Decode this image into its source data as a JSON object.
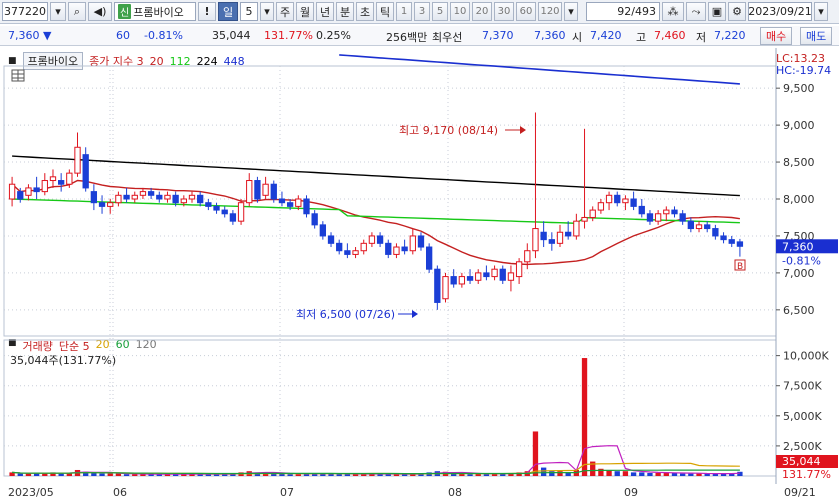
{
  "toolbar": {
    "code": "377220",
    "new_badge": "신",
    "stock_name": "프롬바이오",
    "alert_label": "!",
    "periods": [
      "일",
      "5",
      "주",
      "월",
      "년",
      "분",
      "초",
      "틱"
    ],
    "numbers": [
      "1",
      "3",
      "5",
      "10",
      "20",
      "30",
      "60",
      "120"
    ],
    "count": "92",
    "total": "/493",
    "date": "2023/09/21"
  },
  "quote": {
    "price": "7,360",
    "change": "60",
    "change_pct": "-0.81%",
    "volume": "35,044",
    "volume_ratio": "131.77%",
    "turnover_pct": "0.25%",
    "amount": "256백만",
    "best_ask_label": "최우선",
    "best_ask": "7,370",
    "best_bid": "7,360",
    "open_label": "시",
    "open": "7,420",
    "high_label": "고",
    "high": "7,460",
    "low_label": "저",
    "low": "7,220",
    "buy_label": "매수",
    "sell_label": "매도"
  },
  "legend": {
    "name": "프롬바이오",
    "series_label": "종가 지수 3",
    "ma": [
      "20",
      "112",
      "224",
      "448"
    ]
  },
  "volume_legend": {
    "label": "거래량",
    "ma_label": "단순 5",
    "ma": [
      "20",
      "60",
      "120"
    ],
    "current": "35,044주(131.77%)"
  },
  "annotations": {
    "high": "최고 9,170 (08/14)",
    "low": "최저 6,500 (07/26)",
    "lc": "LC:13.23",
    "hc": "HC:-19.74",
    "marker": "B"
  },
  "price_tag": {
    "price": "7,360",
    "pct": "-0.81%"
  },
  "volume_tag": {
    "value": "35,044",
    "pct": "131.77%"
  },
  "colors": {
    "up": "#e0141e",
    "down": "#1b3fd6",
    "ma20": "#c42020",
    "ma112": "#16c816",
    "ma224": "#000000",
    "ma448": "#1a2fd0"
  },
  "chart_data": {
    "type": "candlestick",
    "price_axis": {
      "min": 6200,
      "max": 9800,
      "ticks": [
        "9,500",
        "9,000",
        "8,500",
        "8,000",
        "7,500",
        "7,000",
        "6,500"
      ]
    },
    "volume_axis": {
      "ticks": [
        "10,000K",
        "7,500K",
        "5,000K",
        "2,500K"
      ]
    },
    "x_labels": [
      "2023/05",
      "06",
      "07",
      "08",
      "09",
      "09/21"
    ],
    "candles": [
      {
        "o": 8000,
        "h": 8300,
        "l": 7900,
        "c": 8200
      },
      {
        "o": 8100,
        "h": 8150,
        "l": 7950,
        "c": 8000
      },
      {
        "o": 8050,
        "h": 8200,
        "l": 7980,
        "c": 8150
      },
      {
        "o": 8150,
        "h": 8300,
        "l": 8000,
        "c": 8100
      },
      {
        "o": 8100,
        "h": 8350,
        "l": 8050,
        "c": 8250
      },
      {
        "o": 8250,
        "h": 8400,
        "l": 8150,
        "c": 8300
      },
      {
        "o": 8250,
        "h": 8350,
        "l": 8100,
        "c": 8200
      },
      {
        "o": 8200,
        "h": 8400,
        "l": 8150,
        "c": 8350
      },
      {
        "o": 8350,
        "h": 8900,
        "l": 8300,
        "c": 8700
      },
      {
        "o": 8600,
        "h": 8700,
        "l": 8100,
        "c": 8150
      },
      {
        "o": 8100,
        "h": 8200,
        "l": 7850,
        "c": 7950
      },
      {
        "o": 7950,
        "h": 8050,
        "l": 7800,
        "c": 7900
      },
      {
        "o": 7900,
        "h": 8000,
        "l": 7800,
        "c": 7950
      },
      {
        "o": 7950,
        "h": 8100,
        "l": 7900,
        "c": 8050
      },
      {
        "o": 8050,
        "h": 8150,
        "l": 7950,
        "c": 8000
      },
      {
        "o": 8000,
        "h": 8100,
        "l": 7950,
        "c": 8050
      },
      {
        "o": 8050,
        "h": 8150,
        "l": 8000,
        "c": 8100
      },
      {
        "o": 8100,
        "h": 8150,
        "l": 8000,
        "c": 8050
      },
      {
        "o": 8050,
        "h": 8100,
        "l": 7950,
        "c": 8000
      },
      {
        "o": 8000,
        "h": 8100,
        "l": 7950,
        "c": 8050
      },
      {
        "o": 8050,
        "h": 8100,
        "l": 7900,
        "c": 7950
      },
      {
        "o": 7950,
        "h": 8050,
        "l": 7900,
        "c": 8000
      },
      {
        "o": 8000,
        "h": 8100,
        "l": 7950,
        "c": 8050
      },
      {
        "o": 8050,
        "h": 8100,
        "l": 7900,
        "c": 7950
      },
      {
        "o": 7950,
        "h": 8000,
        "l": 7850,
        "c": 7900
      },
      {
        "o": 7900,
        "h": 7950,
        "l": 7800,
        "c": 7850
      },
      {
        "o": 7850,
        "h": 7900,
        "l": 7750,
        "c": 7800
      },
      {
        "o": 7800,
        "h": 7850,
        "l": 7650,
        "c": 7700
      },
      {
        "o": 7700,
        "h": 8000,
        "l": 7650,
        "c": 7950
      },
      {
        "o": 7950,
        "h": 8350,
        "l": 7900,
        "c": 8250
      },
      {
        "o": 8250,
        "h": 8300,
        "l": 7950,
        "c": 8000
      },
      {
        "o": 8050,
        "h": 8300,
        "l": 8000,
        "c": 8200
      },
      {
        "o": 8200,
        "h": 8250,
        "l": 7950,
        "c": 8000
      },
      {
        "o": 8000,
        "h": 8100,
        "l": 7900,
        "c": 7950
      },
      {
        "o": 7950,
        "h": 8000,
        "l": 7850,
        "c": 7900
      },
      {
        "o": 7900,
        "h": 8050,
        "l": 7850,
        "c": 8000
      },
      {
        "o": 8000,
        "h": 8050,
        "l": 7750,
        "c": 7800
      },
      {
        "o": 7800,
        "h": 7850,
        "l": 7600,
        "c": 7650
      },
      {
        "o": 7650,
        "h": 7700,
        "l": 7450,
        "c": 7500
      },
      {
        "o": 7500,
        "h": 7550,
        "l": 7350,
        "c": 7400
      },
      {
        "o": 7400,
        "h": 7450,
        "l": 7250,
        "c": 7300
      },
      {
        "o": 7300,
        "h": 7400,
        "l": 7200,
        "c": 7250
      },
      {
        "o": 7250,
        "h": 7350,
        "l": 7200,
        "c": 7300
      },
      {
        "o": 7300,
        "h": 7450,
        "l": 7250,
        "c": 7400
      },
      {
        "o": 7400,
        "h": 7550,
        "l": 7350,
        "c": 7500
      },
      {
        "o": 7500,
        "h": 7550,
        "l": 7350,
        "c": 7400
      },
      {
        "o": 7400,
        "h": 7450,
        "l": 7200,
        "c": 7250
      },
      {
        "o": 7250,
        "h": 7400,
        "l": 7200,
        "c": 7350
      },
      {
        "o": 7350,
        "h": 7450,
        "l": 7250,
        "c": 7300
      },
      {
        "o": 7300,
        "h": 7600,
        "l": 7250,
        "c": 7500
      },
      {
        "o": 7500,
        "h": 7550,
        "l": 7300,
        "c": 7350
      },
      {
        "o": 7350,
        "h": 7400,
        "l": 7000,
        "c": 7050
      },
      {
        "o": 7050,
        "h": 7100,
        "l": 6500,
        "c": 6600
      },
      {
        "o": 6650,
        "h": 7000,
        "l": 6600,
        "c": 6950
      },
      {
        "o": 6950,
        "h": 7050,
        "l": 6800,
        "c": 6850
      },
      {
        "o": 6850,
        "h": 7000,
        "l": 6800,
        "c": 6950
      },
      {
        "o": 6950,
        "h": 7050,
        "l": 6850,
        "c": 6900
      },
      {
        "o": 6900,
        "h": 7050,
        "l": 6850,
        "c": 7000
      },
      {
        "o": 7000,
        "h": 7100,
        "l": 6900,
        "c": 6950
      },
      {
        "o": 6950,
        "h": 7100,
        "l": 6900,
        "c": 7050
      },
      {
        "o": 7050,
        "h": 7100,
        "l": 6850,
        "c": 6900
      },
      {
        "o": 6900,
        "h": 7100,
        "l": 6750,
        "c": 7000
      },
      {
        "o": 6950,
        "h": 7200,
        "l": 6850,
        "c": 7150
      },
      {
        "o": 7150,
        "h": 7400,
        "l": 7050,
        "c": 7300
      },
      {
        "o": 7300,
        "h": 9170,
        "l": 7200,
        "c": 7600
      },
      {
        "o": 7550,
        "h": 7700,
        "l": 7350,
        "c": 7450
      },
      {
        "o": 7450,
        "h": 7550,
        "l": 7300,
        "c": 7400
      },
      {
        "o": 7400,
        "h": 7650,
        "l": 7350,
        "c": 7550
      },
      {
        "o": 7550,
        "h": 7700,
        "l": 7450,
        "c": 7500
      },
      {
        "o": 7500,
        "h": 7800,
        "l": 7450,
        "c": 7700
      },
      {
        "o": 7700,
        "h": 8950,
        "l": 7600,
        "c": 7750
      },
      {
        "o": 7750,
        "h": 7900,
        "l": 7700,
        "c": 7850
      },
      {
        "o": 7850,
        "h": 8000,
        "l": 7800,
        "c": 7950
      },
      {
        "o": 7950,
        "h": 8100,
        "l": 7850,
        "c": 8050
      },
      {
        "o": 8050,
        "h": 8100,
        "l": 7900,
        "c": 7950
      },
      {
        "o": 7950,
        "h": 8050,
        "l": 7850,
        "c": 8000
      },
      {
        "o": 8000,
        "h": 8100,
        "l": 7850,
        "c": 7900
      },
      {
        "o": 7900,
        "h": 8000,
        "l": 7750,
        "c": 7800
      },
      {
        "o": 7800,
        "h": 7850,
        "l": 7650,
        "c": 7700
      },
      {
        "o": 7700,
        "h": 7850,
        "l": 7650,
        "c": 7800
      },
      {
        "o": 7800,
        "h": 7900,
        "l": 7700,
        "c": 7850
      },
      {
        "o": 7850,
        "h": 7900,
        "l": 7750,
        "c": 7800
      },
      {
        "o": 7800,
        "h": 7850,
        "l": 7650,
        "c": 7700
      },
      {
        "o": 7700,
        "h": 7750,
        "l": 7550,
        "c": 7600
      },
      {
        "o": 7600,
        "h": 7700,
        "l": 7550,
        "c": 7650
      },
      {
        "o": 7650,
        "h": 7700,
        "l": 7550,
        "c": 7600
      },
      {
        "o": 7600,
        "h": 7650,
        "l": 7450,
        "c": 7500
      },
      {
        "o": 7500,
        "h": 7550,
        "l": 7400,
        "c": 7450
      },
      {
        "o": 7450,
        "h": 7500,
        "l": 7350,
        "c": 7400
      },
      {
        "o": 7420,
        "h": 7460,
        "l": 7220,
        "c": 7360
      }
    ],
    "volumes": [
      0.3,
      0.2,
      0.2,
      0.25,
      0.2,
      0.3,
      0.2,
      0.25,
      0.5,
      0.35,
      0.25,
      0.2,
      0.2,
      0.2,
      0.15,
      0.15,
      0.15,
      0.15,
      0.15,
      0.15,
      0.15,
      0.15,
      0.15,
      0.15,
      0.15,
      0.15,
      0.15,
      0.2,
      0.3,
      0.4,
      0.3,
      0.25,
      0.2,
      0.2,
      0.15,
      0.15,
      0.2,
      0.2,
      0.2,
      0.2,
      0.15,
      0.15,
      0.15,
      0.2,
      0.2,
      0.15,
      0.15,
      0.15,
      0.15,
      0.2,
      0.15,
      0.3,
      0.4,
      0.35,
      0.2,
      0.2,
      0.15,
      0.2,
      0.15,
      0.2,
      0.2,
      0.25,
      0.3,
      0.4,
      3.7,
      0.7,
      0.4,
      0.4,
      0.3,
      0.5,
      9.8,
      1.2,
      0.6,
      0.5,
      0.4,
      0.4,
      0.3,
      0.3,
      0.25,
      0.25,
      0.3,
      0.25,
      0.2,
      0.2,
      0.2,
      0.2,
      0.2,
      0.2,
      0.2,
      0.35
    ]
  }
}
